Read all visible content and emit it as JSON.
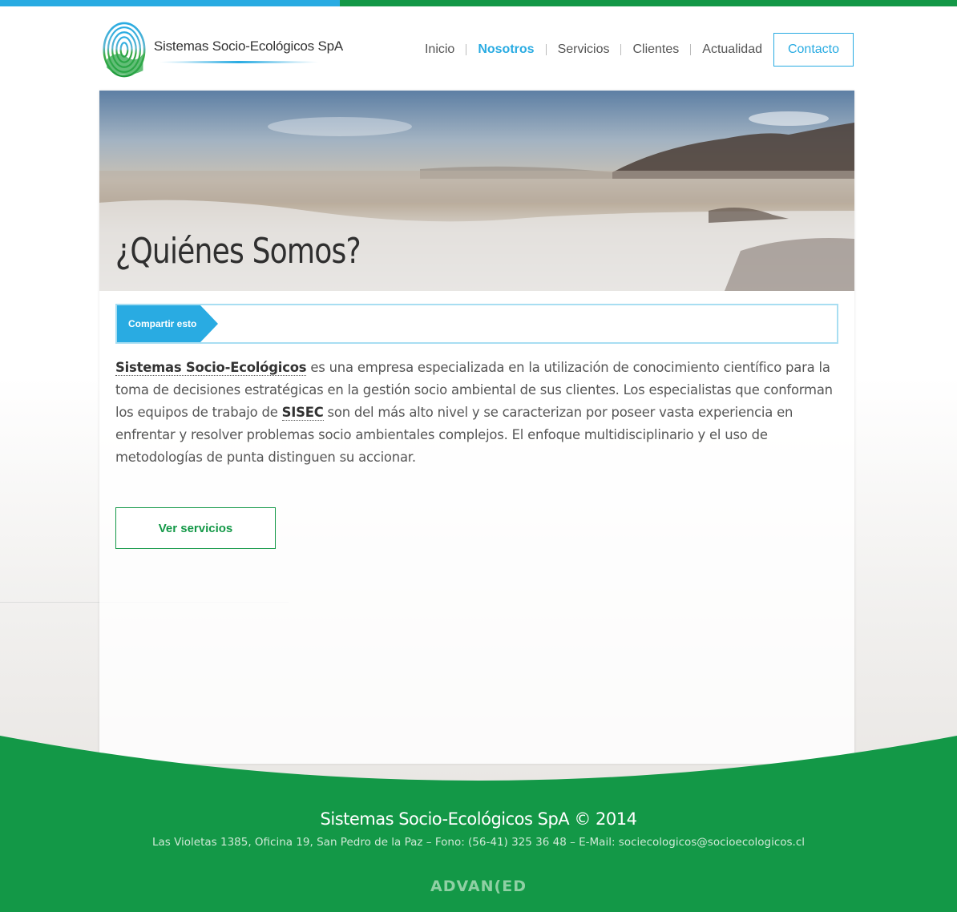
{
  "brand": {
    "name": "Sistemas Socio-Ecológicos SpA",
    "logo_icon": "fingerprint-logo-icon"
  },
  "nav": {
    "items": [
      {
        "label": "Inicio",
        "active": false
      },
      {
        "label": "Nosotros",
        "active": true
      },
      {
        "label": "Servicios",
        "active": false
      },
      {
        "label": "Clientes",
        "active": false
      },
      {
        "label": "Actualidad",
        "active": false
      }
    ],
    "contact_label": "Contacto"
  },
  "hero": {
    "title": "¿Quiénes Somos?"
  },
  "share": {
    "label": "Compartir esto"
  },
  "intro": {
    "company_link": "Sistemas Socio-Ecológicos",
    "text_1": " es una empresa especializada en la utilización de conocimiento científico para la toma de decisiones estratégicas en la gestión socio ambiental de sus clientes. Los especialistas que conforman los equipos de trabajo de ",
    "sisec_link": "SISEC",
    "text_2": " son del más alto nivel y se caracterizan por poseer vasta experiencia en enfrentar y resolver problemas socio ambientales complejos. El enfoque multidisciplinario y el uso de metodologías de punta distinguen su accionar."
  },
  "cta": {
    "label": "Ver servicios"
  },
  "footer": {
    "title": "Sistemas Socio-Ecológicos SpA  © 2014",
    "address": "Las Violetas 1385, Oficina 19, San Pedro de la Paz – Fono: (56-41) 325 36 48 – E-Mail: sociecologicos@socioecologicos.cl",
    "credit": "ADVAN(ED"
  },
  "colors": {
    "accent_blue": "#29abe2",
    "accent_green": "#139847"
  }
}
